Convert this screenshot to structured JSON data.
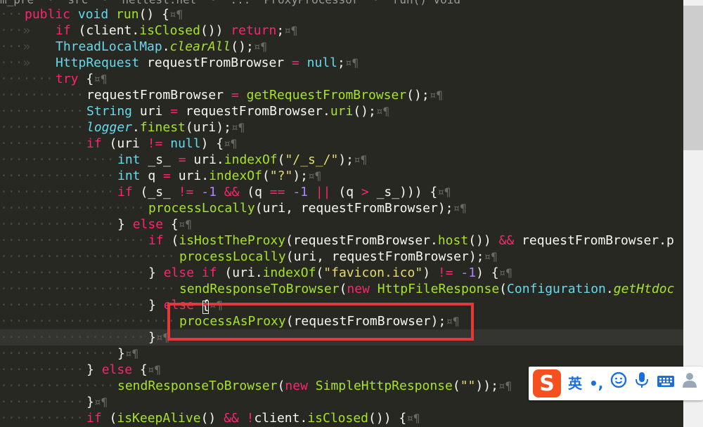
{
  "breadcrumb": {
    "text": "m_pre  ·  src  ·  nettest.net  ·  ...  ProxyProcessor  ·  run() void"
  },
  "editor": {
    "lines": [
      {
        "guide": "···",
        "tokens": [
          {
            "t": "kw",
            "s": "public "
          },
          {
            "t": "type",
            "s": "void "
          },
          {
            "t": "fn",
            "s": "run"
          },
          {
            "t": "pun",
            "s": "() {"
          },
          {
            "t": "mark",
            "s": "¤¶"
          }
        ]
      },
      {
        "guide": "···»   ",
        "tokens": [
          {
            "t": "kw",
            "s": "if "
          },
          {
            "t": "pun",
            "s": "("
          },
          {
            "t": "plain",
            "s": "client"
          },
          {
            "t": "pun",
            "s": "."
          },
          {
            "t": "fn",
            "s": "isClosed"
          },
          {
            "t": "pun",
            "s": "()) "
          },
          {
            "t": "kw",
            "s": "return"
          },
          {
            "t": "pun",
            "s": ";"
          },
          {
            "t": "mark",
            "s": "¤¶"
          }
        ]
      },
      {
        "guide": "···»   ",
        "tokens": [
          {
            "t": "type",
            "s": "ThreadLocalMap"
          },
          {
            "t": "pun",
            "s": "."
          },
          {
            "t": "ital",
            "s": "clearAll"
          },
          {
            "t": "pun",
            "s": "();"
          },
          {
            "t": "mark",
            "s": "¤¶"
          }
        ]
      },
      {
        "guide": "···»   ",
        "tokens": [
          {
            "t": "type",
            "s": "HttpRequest "
          },
          {
            "t": "plain",
            "s": "requestFromBrowser "
          },
          {
            "t": "kw",
            "s": "= "
          },
          {
            "t": "type",
            "s": "null"
          },
          {
            "t": "pun",
            "s": ";"
          },
          {
            "t": "mark",
            "s": "¤¶"
          }
        ]
      },
      {
        "guide": "·······",
        "tokens": [
          {
            "t": "kw",
            "s": "try "
          },
          {
            "t": "pun",
            "s": "{"
          },
          {
            "t": "mark",
            "s": "¤¶"
          }
        ]
      },
      {
        "guide": "···········",
        "tokens": [
          {
            "t": "plain",
            "s": "requestFromBrowser "
          },
          {
            "t": "kw",
            "s": "= "
          },
          {
            "t": "fn",
            "s": "getRequestFromBrowser"
          },
          {
            "t": "pun",
            "s": "();"
          },
          {
            "t": "mark",
            "s": "¤¶"
          }
        ]
      },
      {
        "guide": "···········",
        "tokens": [
          {
            "t": "type",
            "s": "String "
          },
          {
            "t": "plain",
            "s": "uri "
          },
          {
            "t": "kw",
            "s": "= "
          },
          {
            "t": "plain",
            "s": "requestFromBrowser"
          },
          {
            "t": "pun",
            "s": "."
          },
          {
            "t": "fn",
            "s": "uri"
          },
          {
            "t": "pun",
            "s": "();"
          },
          {
            "t": "mark",
            "s": "¤¶"
          }
        ]
      },
      {
        "guide": "···········",
        "tokens": [
          {
            "t": "static",
            "s": "logger"
          },
          {
            "t": "pun",
            "s": "."
          },
          {
            "t": "fn",
            "s": "finest"
          },
          {
            "t": "pun",
            "s": "(uri);"
          },
          {
            "t": "mark",
            "s": "¤¶"
          }
        ]
      },
      {
        "guide": "···········",
        "tokens": [
          {
            "t": "kw",
            "s": "if "
          },
          {
            "t": "pun",
            "s": "("
          },
          {
            "t": "plain",
            "s": "uri "
          },
          {
            "t": "kw",
            "s": "!= "
          },
          {
            "t": "type",
            "s": "null"
          },
          {
            "t": "pun",
            "s": ") {"
          },
          {
            "t": "mark",
            "s": "¤¶"
          }
        ]
      },
      {
        "guide": "···············",
        "tokens": [
          {
            "t": "type",
            "s": "int "
          },
          {
            "t": "plain",
            "s": "_s_ "
          },
          {
            "t": "kw",
            "s": "= "
          },
          {
            "t": "plain",
            "s": "uri"
          },
          {
            "t": "pun",
            "s": "."
          },
          {
            "t": "fn",
            "s": "indexOf"
          },
          {
            "t": "pun",
            "s": "("
          },
          {
            "t": "str",
            "s": "\"/_s_/\""
          },
          {
            "t": "pun",
            "s": ");"
          },
          {
            "t": "mark",
            "s": "¤¶"
          }
        ]
      },
      {
        "guide": "···············",
        "tokens": [
          {
            "t": "type",
            "s": "int "
          },
          {
            "t": "plain",
            "s": "q "
          },
          {
            "t": "kw",
            "s": "= "
          },
          {
            "t": "plain",
            "s": "uri"
          },
          {
            "t": "pun",
            "s": "."
          },
          {
            "t": "fn",
            "s": "indexOf"
          },
          {
            "t": "pun",
            "s": "("
          },
          {
            "t": "str",
            "s": "\"?\""
          },
          {
            "t": "pun",
            "s": ");"
          },
          {
            "t": "mark",
            "s": "¤¶"
          }
        ]
      },
      {
        "guide": "···············",
        "tokens": [
          {
            "t": "kw",
            "s": "if "
          },
          {
            "t": "pun",
            "s": "("
          },
          {
            "t": "plain",
            "s": "_s_ "
          },
          {
            "t": "kw",
            "s": "!= "
          },
          {
            "t": "num",
            "s": "-1 "
          },
          {
            "t": "kw",
            "s": "&& "
          },
          {
            "t": "pun",
            "s": "("
          },
          {
            "t": "plain",
            "s": "q "
          },
          {
            "t": "kw",
            "s": "== "
          },
          {
            "t": "num",
            "s": "-1 "
          },
          {
            "t": "kw",
            "s": "|| "
          },
          {
            "t": "pun",
            "s": "("
          },
          {
            "t": "plain",
            "s": "q "
          },
          {
            "t": "kw",
            "s": "> "
          },
          {
            "t": "plain",
            "s": "_s_"
          },
          {
            "t": "pun",
            "s": "))) {"
          },
          {
            "t": "mark",
            "s": "¤¶"
          }
        ]
      },
      {
        "guide": "···················",
        "tokens": [
          {
            "t": "fn",
            "s": "processLocally"
          },
          {
            "t": "pun",
            "s": "("
          },
          {
            "t": "plain",
            "s": "uri, requestFromBrowser"
          },
          {
            "t": "pun",
            "s": ");"
          },
          {
            "t": "mark",
            "s": "¤¶"
          }
        ]
      },
      {
        "guide": "···············",
        "tokens": [
          {
            "t": "pun",
            "s": "} "
          },
          {
            "t": "kw",
            "s": "else "
          },
          {
            "t": "pun",
            "s": "{"
          },
          {
            "t": "mark",
            "s": "¤¶"
          }
        ]
      },
      {
        "guide": "···················",
        "tokens": [
          {
            "t": "kw",
            "s": "if "
          },
          {
            "t": "pun",
            "s": "("
          },
          {
            "t": "fn",
            "s": "isHostTheProxy"
          },
          {
            "t": "pun",
            "s": "("
          },
          {
            "t": "plain",
            "s": "requestFromBrowser"
          },
          {
            "t": "pun",
            "s": "."
          },
          {
            "t": "fn",
            "s": "host"
          },
          {
            "t": "pun",
            "s": "()) "
          },
          {
            "t": "kw",
            "s": "&& "
          },
          {
            "t": "plain",
            "s": "requestFromBrowser"
          },
          {
            "t": "pun",
            "s": ".p"
          }
        ]
      },
      {
        "guide": "·······················",
        "tokens": [
          {
            "t": "fn",
            "s": "processLocally"
          },
          {
            "t": "pun",
            "s": "("
          },
          {
            "t": "plain",
            "s": "uri, requestFromBrowser"
          },
          {
            "t": "pun",
            "s": ");"
          },
          {
            "t": "mark",
            "s": "¤¶"
          }
        ]
      },
      {
        "guide": "···················",
        "tokens": [
          {
            "t": "pun",
            "s": "} "
          },
          {
            "t": "kw",
            "s": "else if "
          },
          {
            "t": "pun",
            "s": "("
          },
          {
            "t": "plain",
            "s": "uri"
          },
          {
            "t": "pun",
            "s": "."
          },
          {
            "t": "fn",
            "s": "indexOf"
          },
          {
            "t": "pun",
            "s": "("
          },
          {
            "t": "str",
            "s": "\"favicon.ico\""
          },
          {
            "t": "pun",
            "s": ") "
          },
          {
            "t": "kw",
            "s": "!= "
          },
          {
            "t": "num",
            "s": "-1"
          },
          {
            "t": "pun",
            "s": ") {"
          },
          {
            "t": "mark",
            "s": "¤¶"
          }
        ]
      },
      {
        "guide": "·······················",
        "tokens": [
          {
            "t": "fn",
            "s": "sendResponseToBrowser"
          },
          {
            "t": "pun",
            "s": "("
          },
          {
            "t": "kw",
            "s": "new "
          },
          {
            "t": "fn",
            "s": "HttpFileResponse"
          },
          {
            "t": "pun",
            "s": "("
          },
          {
            "t": "type",
            "s": "Configuration"
          },
          {
            "t": "pun",
            "s": "."
          },
          {
            "t": "ital",
            "s": "getHtdoc"
          }
        ]
      },
      {
        "guide": "···················",
        "tokens": [
          {
            "t": "pun",
            "s": "} "
          },
          {
            "t": "kw",
            "s": "else "
          },
          {
            "t": "pun",
            "s": "{"
          },
          {
            "t": "mark",
            "s": "¤¶"
          }
        ]
      },
      {
        "guide": "·······················",
        "tokens": [
          {
            "t": "fn",
            "s": "processAsProxy"
          },
          {
            "t": "pun",
            "s": "("
          },
          {
            "t": "plain",
            "s": "requestFromBrowser"
          },
          {
            "t": "pun",
            "s": ");"
          },
          {
            "t": "mark",
            "s": "¤¶"
          }
        ]
      },
      {
        "guide": "···················",
        "current": true,
        "tokens": [
          {
            "t": "pun",
            "s": "}"
          },
          {
            "t": "mark",
            "s": "¤¶"
          }
        ]
      },
      {
        "guide": "···············",
        "tokens": [
          {
            "t": "pun",
            "s": "}"
          },
          {
            "t": "mark",
            "s": "¤¶"
          }
        ]
      },
      {
        "guide": "···········",
        "tokens": [
          {
            "t": "pun",
            "s": "} "
          },
          {
            "t": "kw",
            "s": "else "
          },
          {
            "t": "pun",
            "s": "{"
          },
          {
            "t": "mark",
            "s": "¤¶"
          }
        ]
      },
      {
        "guide": "···············",
        "tokens": [
          {
            "t": "fn",
            "s": "sendResponseToBrowser"
          },
          {
            "t": "pun",
            "s": "("
          },
          {
            "t": "kw",
            "s": "new "
          },
          {
            "t": "fn",
            "s": "SimpleHttpResponse"
          },
          {
            "t": "pun",
            "s": "("
          },
          {
            "t": "str",
            "s": "\"\""
          },
          {
            "t": "pun",
            "s": "));"
          },
          {
            "t": "mark",
            "s": "¤¶"
          }
        ]
      },
      {
        "guide": "···········",
        "tokens": [
          {
            "t": "pun",
            "s": "}"
          },
          {
            "t": "mark",
            "s": "¤¶"
          }
        ]
      },
      {
        "guide": "···········",
        "tokens": [
          {
            "t": "kw",
            "s": "if "
          },
          {
            "t": "pun",
            "s": "("
          },
          {
            "t": "fn",
            "s": "isKeepAlive"
          },
          {
            "t": "pun",
            "s": "() "
          },
          {
            "t": "kw",
            "s": "&& "
          },
          {
            "t": "kw",
            "s": "!"
          },
          {
            "t": "plain",
            "s": "client"
          },
          {
            "t": "pun",
            "s": "."
          },
          {
            "t": "fn",
            "s": "isClosed"
          },
          {
            "t": "pun",
            "s": "()) {"
          },
          {
            "t": "mark",
            "s": "¤¶"
          }
        ]
      }
    ]
  },
  "ime": {
    "logo": "S",
    "lang_label": "英",
    "punct_label": "•,",
    "emoji_icon": "smile-icon",
    "voice_icon": "microphone-icon",
    "keyboard_icon": "keyboard-icon",
    "user_icon": "user-icon"
  },
  "colors": {
    "background": "#272822",
    "highlight_box": "#e23a3a",
    "ime_brand": "#f5501e"
  }
}
